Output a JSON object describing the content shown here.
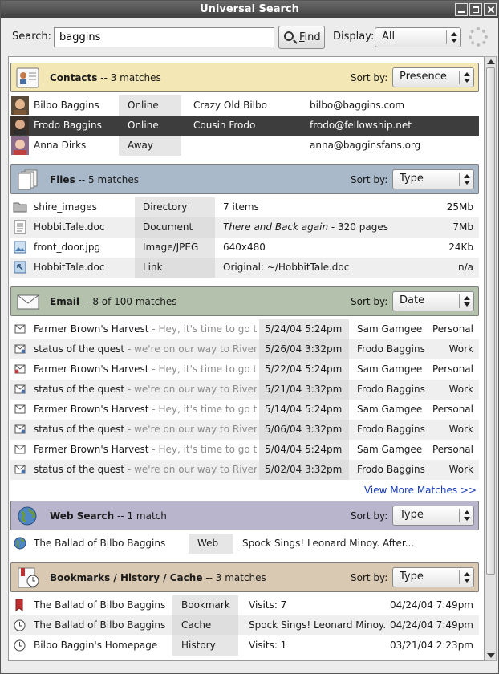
{
  "window": {
    "title": "Universal Search"
  },
  "search": {
    "label": "Search:",
    "value": "baggins",
    "find_label": "ind",
    "find_mnemonic": "F",
    "display_label": "Display:",
    "display_value": "All"
  },
  "sort_label": "Sort by:",
  "contacts": {
    "title": "Contacts",
    "count": " -- 3 matches",
    "sort": "Presence",
    "rows": [
      {
        "name": "Bilbo Baggins",
        "status": "Online",
        "nick": "Crazy Old Bilbo",
        "email": "bilbo@baggins.com"
      },
      {
        "name": "Frodo Baggins",
        "status": "Online",
        "nick": "Cousin Frodo",
        "email": "frodo@fellowship.net"
      },
      {
        "name": "Anna Dirks",
        "status": "Away",
        "nick": "",
        "email": "anna@bagginsfans.org"
      }
    ]
  },
  "files": {
    "title": "Files",
    "count": " -- 5 matches",
    "sort": "Type",
    "rows": [
      {
        "name": "shire_images",
        "type": "Directory",
        "info": "7 items",
        "info_italic": "",
        "size": "25Mb"
      },
      {
        "name": "HobbitTale.doc",
        "type": "Document",
        "info": " - 320 pages",
        "info_italic": "There and Back again",
        "size": "7Mb"
      },
      {
        "name": "front_door.jpg",
        "type": "Image/JPEG",
        "info": "640x480",
        "info_italic": "",
        "size": "24Kb"
      },
      {
        "name": "HobbitTale.doc",
        "type": "Link",
        "info": "Original: ~/HobbitTale.doc",
        "info_italic": "",
        "size": "n/a"
      }
    ]
  },
  "email": {
    "title": "Email",
    "count": " -- 8 of 100 matches",
    "sort": "Date",
    "rows": [
      {
        "subject": "Farmer Brown's Harvest",
        "preview": " - Hey, it's time to go to",
        "date": "5/24/04 5:24pm",
        "from": "Sam Gamgee",
        "folder": "Personal"
      },
      {
        "subject": "status of the quest",
        "preview": " - we're on our way to Rivende",
        "date": "5/26/04 3:32pm",
        "from": "Frodo Baggins",
        "folder": "Work"
      },
      {
        "subject": "Farmer Brown's Harvest",
        "preview": " - Hey, it's time to go to",
        "date": "5/22/04 5:24pm",
        "from": "Sam Gamgee",
        "folder": "Personal"
      },
      {
        "subject": "status of the quest",
        "preview": " - we're on our way to Rivende",
        "date": "5/21/04 3:32pm",
        "from": "Frodo Baggins",
        "folder": "Work"
      },
      {
        "subject": "Farmer Brown's Harvest",
        "preview": " - Hey, it's time to go to",
        "date": "5/14/04 5:24pm",
        "from": "Sam Gamgee",
        "folder": "Personal"
      },
      {
        "subject": "status of the quest",
        "preview": " - we're on our way to Rivende",
        "date": "5/06/04 3:32pm",
        "from": "Frodo Baggins",
        "folder": "Work"
      },
      {
        "subject": "Farmer Brown's Harvest",
        "preview": " - Hey, it's time to go to",
        "date": "5/04/04 5:24pm",
        "from": "Sam Gamgee",
        "folder": "Personal"
      },
      {
        "subject": "status of the quest",
        "preview": " - we're on our way to Rivende",
        "date": "5/02/04 3:32pm",
        "from": "Frodo Baggins",
        "folder": "Work"
      }
    ],
    "more_link": "View More Matches >>"
  },
  "web": {
    "title": "Web Search",
    "count": " -- 1 match",
    "sort": "Type",
    "rows": [
      {
        "name": "The Ballad of Bilbo Baggins",
        "type": "Web",
        "info": "Spock Sings! Leonard Minoy. After..."
      }
    ]
  },
  "bookmarks": {
    "title": "Bookmarks / History / Cache",
    "count": " -- 3 matches",
    "sort": "Type",
    "rows": [
      {
        "name": "The Ballad of Bilbo Baggins",
        "type": "Bookmark",
        "info": "Visits: 7",
        "date": "04/24/04 7:49pm"
      },
      {
        "name": "The Ballad of Bilbo Baggins",
        "type": "Cache",
        "info": "Spock Sings! Leonard Minoy...",
        "date": "04/24/04 7:49pm"
      },
      {
        "name": "Bilbo Baggin's Homepage",
        "type": "History",
        "info": "Visits: 1",
        "date": "03/21/04 2:23pm"
      }
    ]
  },
  "colors": {
    "contacts_head": "#f3e7b6",
    "files_head": "#a9b9c9",
    "email_head": "#b4c2ad",
    "web_head": "#b8b5cc",
    "bookmarks_head": "#d9c9b2",
    "link": "#1a3cb8",
    "selected_row": "#3d3d3d"
  }
}
